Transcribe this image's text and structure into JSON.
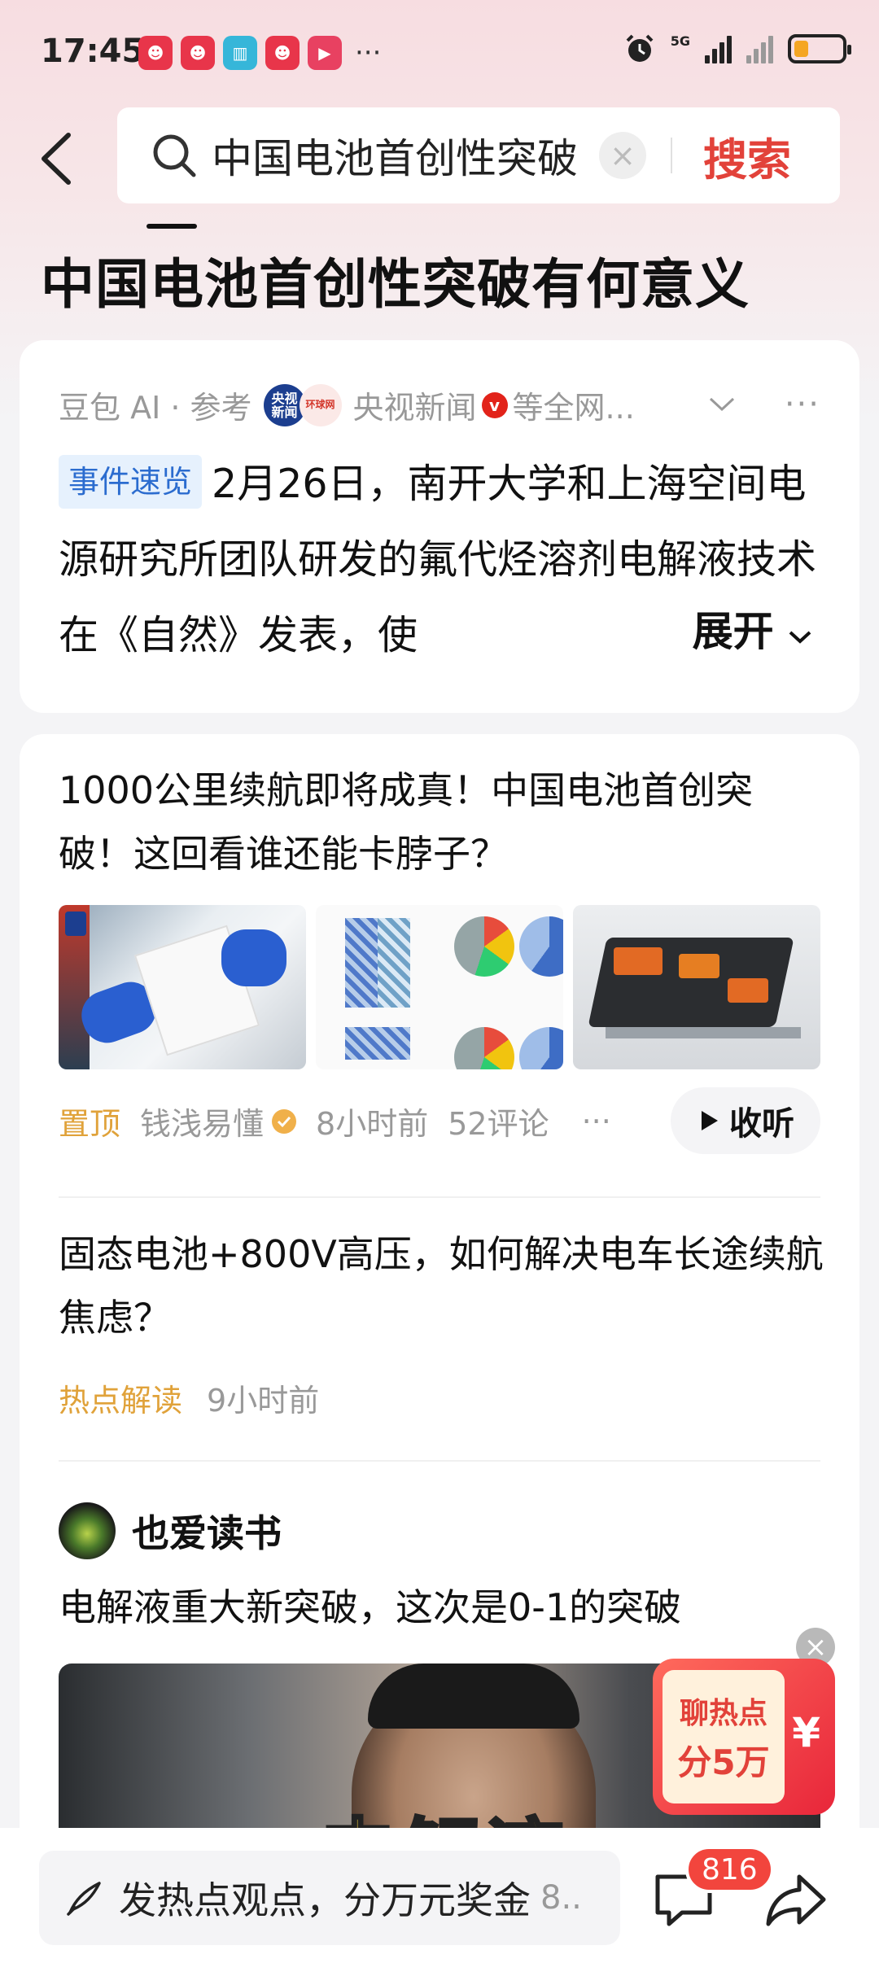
{
  "status_bar": {
    "time": "17:45",
    "network": "5G",
    "app_icons": [
      {
        "name": "video-app-icon",
        "color": "#e8354a",
        "glyph": "☻"
      },
      {
        "name": "video-app-icon",
        "color": "#e8354a",
        "glyph": "☻"
      },
      {
        "name": "reader-app-icon",
        "color": "#36b6d9",
        "glyph": "▥"
      },
      {
        "name": "video-app-icon",
        "color": "#e8354a",
        "glyph": "☻"
      },
      {
        "name": "play-app-icon",
        "color": "#e84161",
        "glyph": "▶"
      }
    ],
    "battery_level": 0.3
  },
  "search": {
    "query": "中国电池首创性突破",
    "button_label": "搜索"
  },
  "page_title": "中国电池首创性突破有何意义",
  "ai_card": {
    "source_prefix": "豆包 AI · 参考",
    "source_name": "央视新闻",
    "source_suffix": "等全网...",
    "logo_text": "央视新闻",
    "tag": "事件速览",
    "summary": "2月26日，南开大学和上海空间电源研究所团队研发的氟代烃溶剂电解液技术在《自然》发表，使",
    "expand_label": "展开"
  },
  "feed": [
    {
      "title": "1000公里续航即将成真！中国电池首创突破！这回看谁还能卡脖子？",
      "pinned_label": "置顶",
      "author": "钱浅易懂",
      "time": "8小时前",
      "comments": "52评论",
      "listen_label": "收听"
    },
    {
      "title": "固态电池+800V高压，如何解决电车长途续航焦虑？",
      "tag": "热点解读",
      "time": "9小时前"
    },
    {
      "author": "也爱读书",
      "title": "电解液重大新突破，这次是0-1的突破",
      "video_caption": "电解液"
    }
  ],
  "promo": {
    "line1": "聊热点",
    "line2": "分5万",
    "symbol": "¥"
  },
  "bottom_bar": {
    "input_text": "发热点观点，分万元奖金",
    "input_suffix": "8..",
    "comment_badge": "816"
  },
  "colors": {
    "accent_red": "#e2423a",
    "pin_orange": "#e0a23a",
    "tag_blue": "#2b6ccf"
  }
}
